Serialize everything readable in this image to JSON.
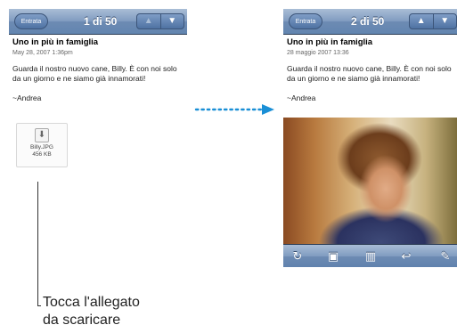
{
  "left_screen": {
    "back_label": "Entrata",
    "title": "1 di 50",
    "arrows": {
      "up": "▲",
      "down": "▼"
    },
    "subject": "Uno in più in famiglia",
    "date": "May 28, 2007 1:36pm",
    "body": "Guarda il nostro nuovo cane, Billy. È con noi solo da un giorno e ne siamo già innamorati!",
    "signature": "~Andrea",
    "attachment": {
      "icon": "download-icon",
      "glyph": "⬇",
      "name": "Billy.JPG",
      "size": "456 KB"
    }
  },
  "right_screen": {
    "back_label": "Entrata",
    "title": "2 di 50",
    "arrows": {
      "up": "▲",
      "down": "▼"
    },
    "subject": "Uno in più in famiglia",
    "date": "28 maggio 2007 13:36",
    "body": "Guarda il nostro nuovo cane, Billy. È con noi solo da un giorno e ne siamo già innamorati!",
    "signature": "~Andrea",
    "photo_subject": "child-photo",
    "toolbar": [
      {
        "icon": "refresh-icon",
        "glyph": "↻"
      },
      {
        "icon": "move-icon",
        "glyph": "▣"
      },
      {
        "icon": "trash-icon",
        "glyph": "▥"
      },
      {
        "icon": "reply-icon",
        "glyph": "↩"
      },
      {
        "icon": "compose-icon",
        "glyph": "✎"
      }
    ]
  },
  "callout": {
    "line1": "Tocca l'allegato",
    "line2": "da scaricare"
  },
  "colors": {
    "accent": "#1a8fd6",
    "navbar": "#6d8bb3"
  }
}
